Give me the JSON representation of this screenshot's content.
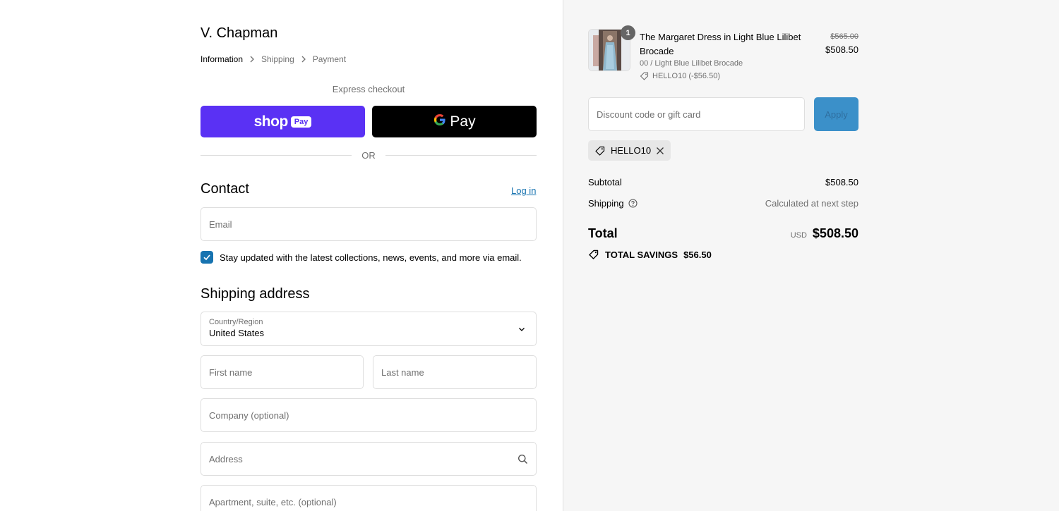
{
  "store": {
    "name": "V. Chapman"
  },
  "breadcrumb": [
    {
      "label": "Information",
      "active": true
    },
    {
      "label": "Shipping",
      "active": false
    },
    {
      "label": "Payment",
      "active": false
    }
  ],
  "express": {
    "label": "Express checkout",
    "shop_word": "shop",
    "shop_pay_chip": "Pay",
    "gpay_text": "Pay",
    "or_text": "OR"
  },
  "contact": {
    "title": "Contact",
    "login_label": "Log in",
    "email_placeholder": "Email",
    "newsletter_label": "Stay updated with the latest collections, news, events, and more via email.",
    "newsletter_checked": true
  },
  "shipping_address": {
    "title": "Shipping address",
    "country_label": "Country/Region",
    "country_value": "United States",
    "first_name_placeholder": "First name",
    "last_name_placeholder": "Last name",
    "company_placeholder": "Company (optional)",
    "address_placeholder": "Address",
    "apartment_placeholder": "Apartment, suite, etc. (optional)"
  },
  "cart": {
    "item": {
      "quantity": "1",
      "name": "The Margaret Dress in Light Blue Lilibet Brocade",
      "variant": "00 / Light Blue Lilibet Brocade",
      "discount": "HELLO10 (-$56.50)",
      "price_original": "$565.00",
      "price_final": "$508.50"
    },
    "discount_placeholder": "Discount code or gift card",
    "apply_label": "Apply",
    "applied_code": "HELLO10",
    "subtotal_label": "Subtotal",
    "subtotal_value": "$508.50",
    "shipping_label": "Shipping",
    "shipping_value": "Calculated at next step",
    "total_label": "Total",
    "currency": "USD",
    "total_value": "$508.50",
    "savings_label": "TOTAL SAVINGS",
    "savings_value": "$56.50"
  },
  "colors": {
    "accent_link": "#1773b0",
    "shop_pay": "#5a31f4",
    "apply_button": "#3b90c9",
    "sidebar_bg": "#f6f6f6"
  }
}
